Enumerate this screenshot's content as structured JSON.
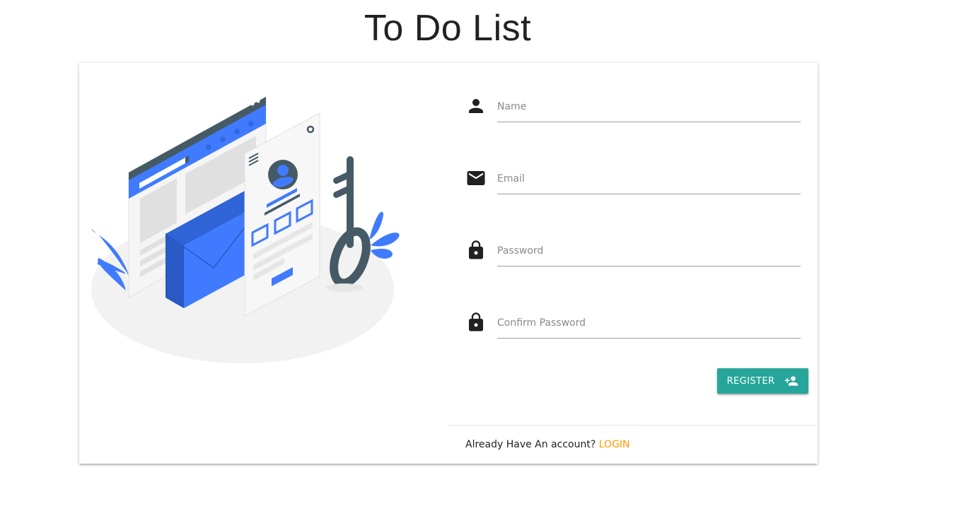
{
  "page": {
    "title": "To Do List"
  },
  "form": {
    "name": {
      "icon": "person-icon",
      "placeholder": "Name",
      "value": ""
    },
    "email": {
      "icon": "email-icon",
      "placeholder": "Email",
      "value": ""
    },
    "password": {
      "icon": "lock-icon",
      "placeholder": "Password",
      "value": ""
    },
    "confirm_password": {
      "icon": "lock-icon",
      "placeholder": "Confirm Password",
      "value": ""
    },
    "register_label": "REGISTER",
    "register_icon": "person-add-icon"
  },
  "footer": {
    "prompt": "Already Have An account?",
    "login_label": "LOGIN"
  },
  "colors": {
    "accent": "#26a69a",
    "link": "#ff9800",
    "illustration_blue": "#407bff",
    "illustration_dark": "#455a64"
  }
}
